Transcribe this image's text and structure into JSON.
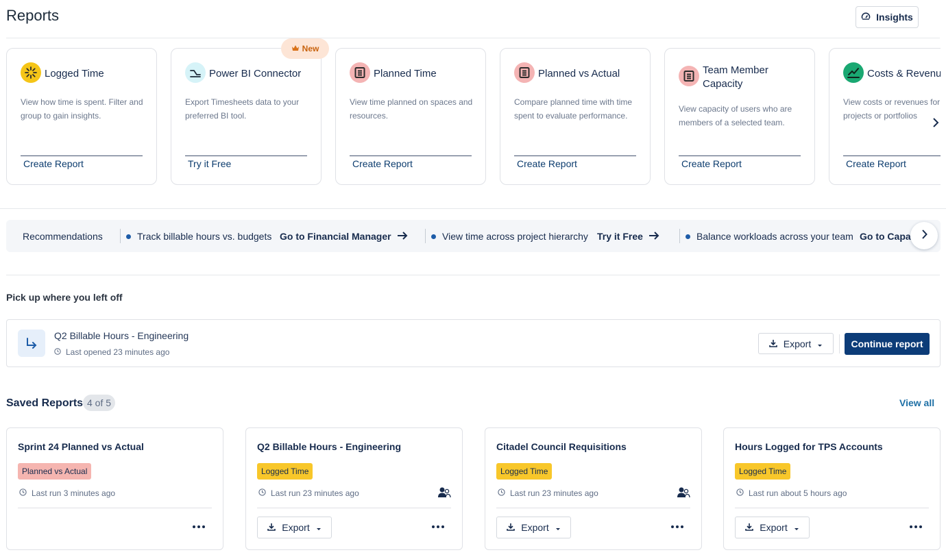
{
  "header": {
    "title": "Reports",
    "insights_label": "Insights"
  },
  "templates": [
    {
      "title": "Logged Time",
      "desc": "View how time is spent. Filter and group to gain insights.",
      "action": "Create Report",
      "icon": "sun-burst-icon",
      "color": "#f5c518"
    },
    {
      "title": "Power BI Connector",
      "desc": "Export Timesheets data to your preferred BI tool.",
      "action": "Try it Free",
      "icon": "power-bi-icon",
      "color": "#d6f3f8",
      "badge": "New"
    },
    {
      "title": "Planned Time",
      "desc": "View time planned on spaces and resources.",
      "action": "Create Report",
      "icon": "document-list-icon",
      "color": "#f4b4b4"
    },
    {
      "title": "Planned vs Actual",
      "desc": "Compare planned time with time spent to evaluate performance.",
      "action": "Create Report",
      "icon": "document-list-icon",
      "color": "#f4b4b4"
    },
    {
      "title": "Team Member Capacity",
      "desc": "View capacity of users who are members of a selected team.",
      "action": "Create Report",
      "icon": "document-list-icon",
      "color": "#f4b4b4"
    },
    {
      "title": "Costs & Revenue",
      "desc": "View costs or revenues for projects or portfolios",
      "action": "Create Report",
      "icon": "trend-chart-icon",
      "color": "#1aa872"
    }
  ],
  "recommendations": {
    "title": "Recommendations",
    "items": [
      {
        "text": "Track billable hours vs. budgets",
        "link": "Go to Financial Manager"
      },
      {
        "text": "View time across project hierarchy",
        "link": "Try it Free"
      },
      {
        "text": "Balance workloads across your team",
        "link": "Go to Capacity"
      }
    ]
  },
  "resume": {
    "section_label": "Pick up where you left off",
    "name": "Q2 Billable Hours - Engineering",
    "meta": "Last opened 23 minutes ago",
    "export_label": "Export",
    "continue_label": "Continue report"
  },
  "saved": {
    "title": "Saved Reports",
    "count": "4 of 5",
    "view_all": "View all",
    "reports": [
      {
        "name": "Sprint 24 Planned vs Actual",
        "tag": "Planned vs Actual",
        "tag_color": "#f5b5b0",
        "meta": "Last run 3 minutes ago",
        "shared": false,
        "export": false
      },
      {
        "name": "Q2 Billable Hours - Engineering",
        "tag": "Logged Time",
        "tag_color": "#f8c72a",
        "meta": "Last run 23 minutes ago",
        "shared": true,
        "export": true
      },
      {
        "name": "Citadel Council Requisitions",
        "tag": "Logged Time",
        "tag_color": "#f8c72a",
        "meta": "Last run 23 minutes ago",
        "shared": true,
        "export": true
      },
      {
        "name": "Hours Logged for TPS Accounts",
        "tag": "Logged Time",
        "tag_color": "#f8c72a",
        "meta": "Last run about 5 hours ago",
        "shared": false,
        "export": true
      }
    ],
    "export_label": "Export"
  }
}
